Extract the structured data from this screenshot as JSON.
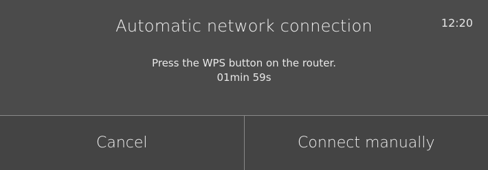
{
  "header": {
    "title": "Automatic network connection",
    "time": "12:20"
  },
  "message": {
    "instruction": "Press the WPS button on the router.",
    "countdown": "01min 59s"
  },
  "actions": {
    "cancel_label": "Cancel",
    "connect_manually_label": "Connect manually"
  }
}
